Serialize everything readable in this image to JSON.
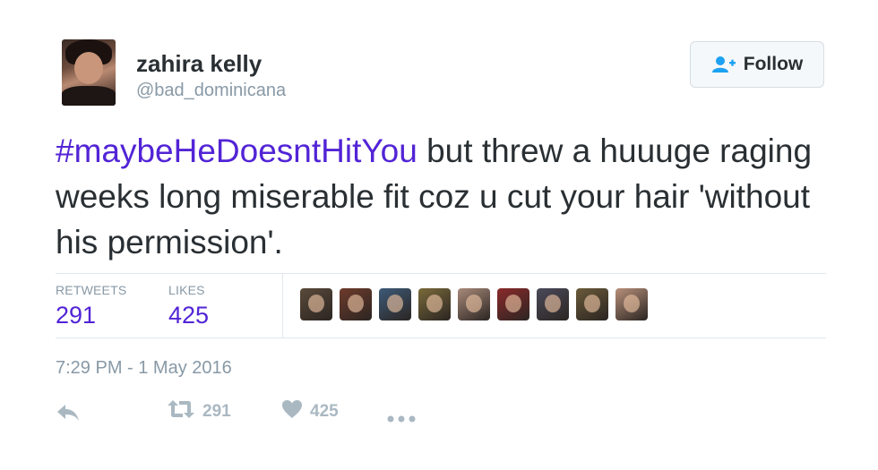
{
  "user": {
    "display_name": "zahira kelly",
    "handle": "@bad_dominicana"
  },
  "follow_button": {
    "label": "Follow",
    "icon": "add-user-icon"
  },
  "tweet": {
    "hashtag": "#maybeHeDoesntHitYou",
    "text": " but threw a huuuge raging weeks long miserable fit coz u cut your hair 'without his permission'."
  },
  "stats": {
    "retweets_label": "RETWEETS",
    "retweets_value": "291",
    "likes_label": "LIKES",
    "likes_value": "425"
  },
  "likers": {
    "colors": [
      "#5a4a3a",
      "#6e3b2c",
      "#3d5a78",
      "#7a6a3a",
      "#a98a7a",
      "#8a2a2a",
      "#4a4a5a",
      "#6a5a3a",
      "#b8907a"
    ]
  },
  "timestamp": "7:29 PM - 1 May 2016",
  "actions": {
    "reply_icon": "reply-icon",
    "retweet_icon": "retweet-icon",
    "retweet_count": "291",
    "like_icon": "heart-icon",
    "like_count": "425",
    "more_icon": "more-dots-icon"
  },
  "colors": {
    "accent": "#5224d6",
    "follow_icon": "#1da1f2",
    "muted": "#8899a6",
    "action": "#aab8c2"
  }
}
